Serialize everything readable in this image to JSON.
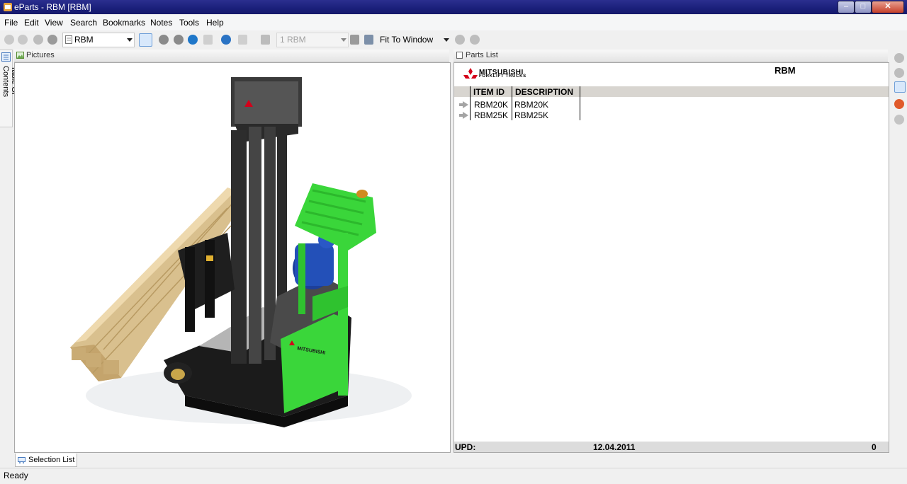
{
  "window": {
    "title": "eParts - RBM [RBM]"
  },
  "menu": [
    {
      "label": "File"
    },
    {
      "label": "Edit"
    },
    {
      "label": "View"
    },
    {
      "label": "Search"
    },
    {
      "label": "Bookmarks"
    },
    {
      "label": "Notes"
    },
    {
      "label": "Tools"
    },
    {
      "label": "Help"
    }
  ],
  "toolbar": {
    "catalog_select": "RBM",
    "page_select": "1 RBM",
    "zoom_select": "Fit To Window"
  },
  "toc_tab": {
    "label": "Table Of Contents"
  },
  "pictures_pane": {
    "title": "Pictures",
    "brand_text": "MITSUBISHI"
  },
  "parts_pane": {
    "title": "Parts List",
    "logo": {
      "line1": "MITSUBISHI",
      "line2": "FORKLIFT TRUCKS"
    },
    "header_title": "RBM",
    "columns": [
      "ITEM ID",
      "DESCRIPTION"
    ],
    "rows": [
      {
        "item_id": "RBM20K",
        "description": "RBM20K"
      },
      {
        "item_id": "RBM25K",
        "description": "RBM25K"
      }
    ],
    "footer": {
      "label": "UPD:",
      "date": "12.04.2011",
      "count": "0"
    }
  },
  "bottom_tab": {
    "label": "Selection List"
  },
  "status": {
    "text": "Ready"
  },
  "colors": {
    "title_bar": "#1a1f7a",
    "forklift_green": "#3ad63a",
    "logo_red": "#d4001a"
  }
}
